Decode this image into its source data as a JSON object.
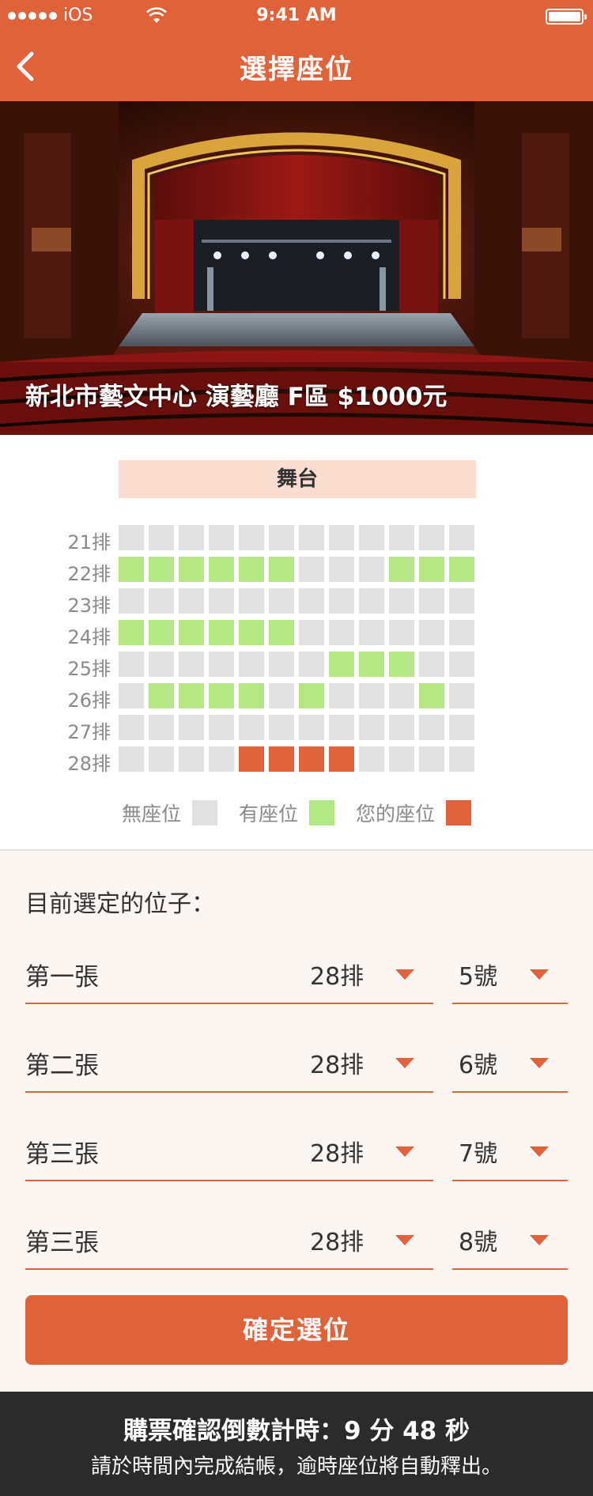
{
  "status_bar": {
    "carrier": "iOS",
    "time": "9:41 AM"
  },
  "nav": {
    "title": "選擇座位"
  },
  "hero": {
    "caption": "新北市藝文中心 演藝廳 F區 $1000元"
  },
  "stage_label": "舞台",
  "seat_map": {
    "rows": [
      {
        "label": "21排",
        "seats": [
          0,
          0,
          0,
          0,
          0,
          0,
          0,
          0,
          0,
          0,
          0,
          0
        ]
      },
      {
        "label": "22排",
        "seats": [
          1,
          1,
          1,
          1,
          1,
          1,
          0,
          0,
          0,
          1,
          1,
          1
        ]
      },
      {
        "label": "23排",
        "seats": [
          0,
          0,
          0,
          0,
          0,
          0,
          0,
          0,
          0,
          0,
          0,
          0
        ]
      },
      {
        "label": "24排",
        "seats": [
          1,
          1,
          1,
          1,
          1,
          1,
          0,
          0,
          0,
          0,
          0,
          0
        ]
      },
      {
        "label": "25排",
        "seats": [
          0,
          0,
          0,
          0,
          0,
          0,
          0,
          1,
          1,
          1,
          0,
          0
        ]
      },
      {
        "label": "26排",
        "seats": [
          0,
          1,
          1,
          1,
          1,
          0,
          1,
          0,
          0,
          0,
          1,
          0
        ]
      },
      {
        "label": "27排",
        "seats": [
          0,
          0,
          0,
          0,
          0,
          0,
          0,
          0,
          0,
          0,
          0,
          0
        ]
      },
      {
        "label": "28排",
        "seats": [
          0,
          0,
          0,
          0,
          2,
          2,
          2,
          2,
          0,
          0,
          0,
          0
        ]
      }
    ]
  },
  "legend": {
    "unavailable": "無座位",
    "available": "有座位",
    "mine": "您的座位"
  },
  "colors": {
    "accent": "#e0623b",
    "unavailable": "#e1e1e1",
    "available": "#b4e684",
    "mine": "#e0623b"
  },
  "selection": {
    "title": "目前選定的位子：",
    "tickets": [
      {
        "label": "第一張",
        "row": "28排",
        "number": "5號"
      },
      {
        "label": "第二張",
        "row": "28排",
        "number": "6號"
      },
      {
        "label": "第三張",
        "row": "28排",
        "number": "7號"
      },
      {
        "label": "第三張",
        "row": "28排",
        "number": "8號"
      }
    ]
  },
  "confirm_label": "確定選位",
  "footer": {
    "countdown": "購票確認倒數計時：9 分 48 秒",
    "note": "請於時間內完成結帳，逾時座位將自動釋出。"
  }
}
